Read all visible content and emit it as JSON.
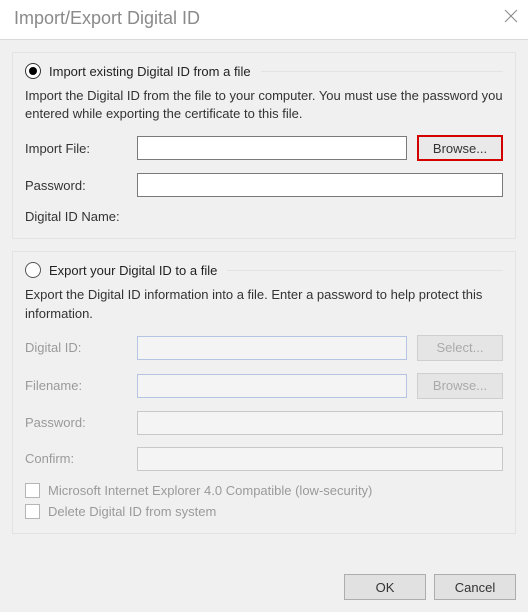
{
  "title": "Import/Export Digital ID",
  "import_group": {
    "radio_label": "Import existing Digital ID from a file",
    "desc": "Import the Digital ID from the file to your computer. You must use the password you entered while exporting the certificate to this file.",
    "import_file_label": "Import File:",
    "import_file_value": "",
    "browse_label": "Browse...",
    "password_label": "Password:",
    "password_value": "",
    "digital_id_name_label": "Digital ID Name:",
    "digital_id_name_value": ""
  },
  "export_group": {
    "radio_label": "Export your Digital ID to a file",
    "desc": "Export the Digital ID information into a file. Enter a password to help protect this information.",
    "digital_id_label": "Digital ID:",
    "digital_id_value": "",
    "select_label": "Select...",
    "filename_label": "Filename:",
    "filename_value": "",
    "browse_label": "Browse...",
    "password_label": "Password:",
    "password_value": "",
    "confirm_label": "Confirm:",
    "confirm_value": "",
    "ie4_label": "Microsoft Internet Explorer 4.0 Compatible (low-security)",
    "delete_label": "Delete Digital ID from system"
  },
  "footer": {
    "ok": "OK",
    "cancel": "Cancel"
  }
}
